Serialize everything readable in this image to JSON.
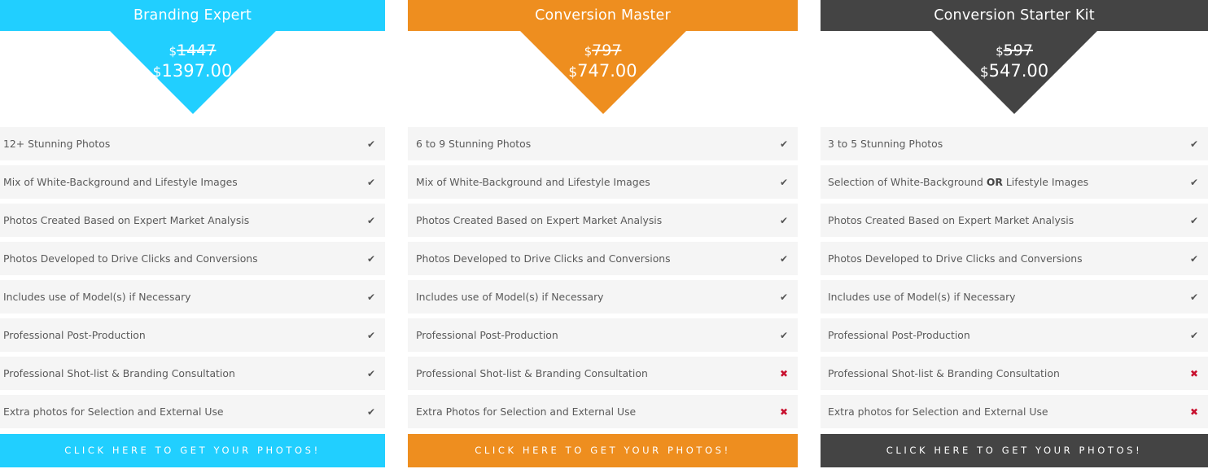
{
  "plans": [
    {
      "name": "Branding Expert",
      "color": "#21cfff",
      "currency": "$",
      "old_price": "1447",
      "new_price": "1397.00",
      "features": [
        {
          "text": "12+ Stunning Photos",
          "included": true,
          "icon": "check-icon"
        },
        {
          "text": "Mix of White-Background and Lifestyle Images",
          "included": true,
          "icon": "check-icon"
        },
        {
          "text": "Photos Created Based on Expert Market Analysis",
          "included": true,
          "icon": "check-icon"
        },
        {
          "text": "Photos Developed to Drive Clicks and Conversions",
          "included": true,
          "icon": "check-icon"
        },
        {
          "text": "Includes use of Model(s) if Necessary",
          "included": true,
          "icon": "check-icon"
        },
        {
          "text": "Professional Post-Production",
          "included": true,
          "icon": "check-icon"
        },
        {
          "text": "Professional Shot-list & Branding Consultation",
          "included": true,
          "icon": "check-icon"
        },
        {
          "text": "Extra photos for Selection and External Use",
          "included": true,
          "icon": "check-icon"
        }
      ],
      "cta_label": "CLICK HERE TO GET YOUR PHOTOS!"
    },
    {
      "name": "Conversion Master",
      "color": "#ee8e1f",
      "currency": "$",
      "old_price": "797",
      "new_price": "747.00",
      "features": [
        {
          "text": "6 to 9 Stunning Photos",
          "included": true,
          "icon": "check-icon"
        },
        {
          "text": "Mix of White-Background and Lifestyle Images",
          "included": true,
          "icon": "check-icon"
        },
        {
          "text": "Photos Created Based on Expert Market Analysis",
          "included": true,
          "icon": "check-icon"
        },
        {
          "text": "Photos Developed to Drive Clicks and Conversions",
          "included": true,
          "icon": "check-icon"
        },
        {
          "text": "Includes use of Model(s) if Necessary",
          "included": true,
          "icon": "check-icon"
        },
        {
          "text": "Professional Post-Production",
          "included": true,
          "icon": "check-icon"
        },
        {
          "text": "Professional Shot-list & Branding Consultation",
          "included": false,
          "icon": "x-icon"
        },
        {
          "text": "Extra Photos for Selection and External Use",
          "included": false,
          "icon": "x-icon"
        }
      ],
      "cta_label": "CLICK HERE TO GET YOUR PHOTOS!"
    },
    {
      "name": "Conversion Starter Kit",
      "color": "#444444",
      "currency": "$",
      "old_price": "597",
      "new_price": "547.00",
      "features": [
        {
          "text": "3 to 5 Stunning Photos",
          "included": true,
          "icon": "check-icon"
        },
        {
          "text_before": "Selection of White-Background ",
          "text_bold": "OR",
          "text_after": " Lifestyle Images",
          "included": true,
          "icon": "check-icon"
        },
        {
          "text": "Photos Created Based on Expert Market Analysis",
          "included": true,
          "icon": "check-icon"
        },
        {
          "text": "Photos Developed to Drive Clicks and Conversions",
          "included": true,
          "icon": "check-icon"
        },
        {
          "text": "Includes use of Model(s) if Necessary",
          "included": true,
          "icon": "check-icon"
        },
        {
          "text": "Professional Post-Production",
          "included": true,
          "icon": "check-icon"
        },
        {
          "text": "Professional Shot-list & Branding Consultation",
          "included": false,
          "icon": "x-icon"
        },
        {
          "text": "Extra photos for Selection and External Use",
          "included": false,
          "icon": "x-icon"
        }
      ],
      "cta_label": "CLICK HERE TO GET YOUR PHOTOS!"
    }
  ],
  "icons": {
    "check-icon": "✔",
    "x-icon": "✖"
  },
  "colors": {
    "row_background": "#f5f5f5",
    "feature_text": "#5a5a5a",
    "check": "#555555",
    "cross": "#c8102e"
  }
}
